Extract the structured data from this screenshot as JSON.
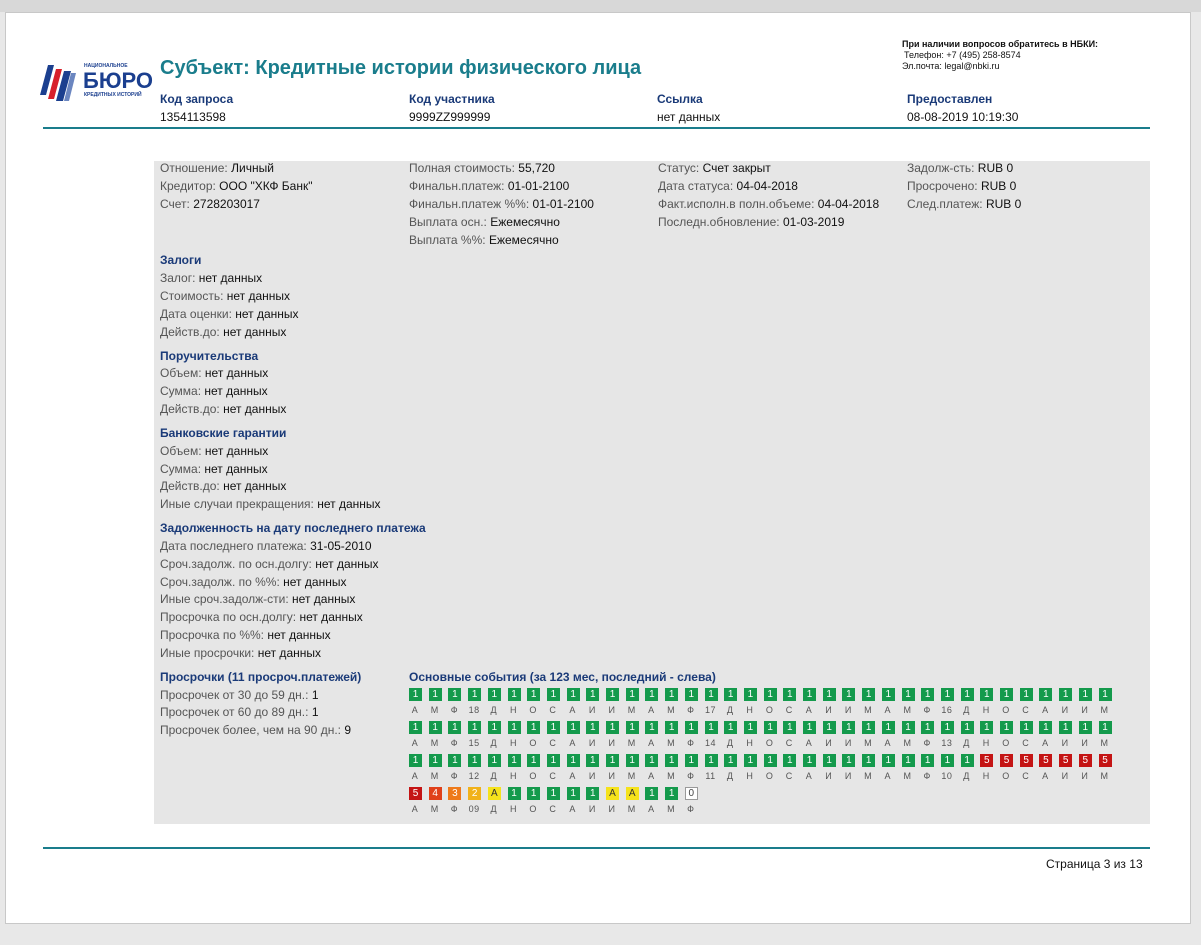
{
  "contact": {
    "title": "При наличии вопросов обратитесь в НБКИ:",
    "phone": "Телефон: +7 (495) 258-8574",
    "email": "Эл.почта: legal@nbki.ru"
  },
  "logo": {
    "top_text": "НАЦИОНАЛЬНОЕ",
    "main_text": "БЮРО",
    "bottom_text": "КРЕДИТНЫХ ИСТОРИЙ"
  },
  "title": "Субъект: Кредитные истории физического лица",
  "header": [
    {
      "label": "Код запроса",
      "value": "1354113598"
    },
    {
      "label": "Код участника",
      "value": "9999ZZ999999"
    },
    {
      "label": "Ссылка",
      "value": "нет данных"
    },
    {
      "label": "Предоставлен",
      "value": "08-08-2019 10:19:30"
    }
  ],
  "account": {
    "col1": [
      {
        "label": "Отношение:",
        "value": "Личный"
      },
      {
        "label": "Кредитор:",
        "value": "ООО \"ХКФ Банк\""
      },
      {
        "label": "Счет:",
        "value": "2728203017"
      }
    ],
    "col2": [
      {
        "label": "Полная стоимость:",
        "value": "55,720"
      },
      {
        "label": "Финальн.платеж:",
        "value": "01-01-2100"
      },
      {
        "label": "Финальн.платеж %%:",
        "value": "01-01-2100"
      },
      {
        "label": "Выплата осн.:",
        "value": "Ежемесячно"
      },
      {
        "label": "Выплата %%:",
        "value": "Ежемесячно"
      }
    ],
    "col3": [
      {
        "label": "Статус:",
        "value": "Счет закрыт"
      },
      {
        "label": "Дата статуса:",
        "value": "04-04-2018"
      },
      {
        "label": "Факт.исполн.в полн.объеме:",
        "value": "04-04-2018"
      },
      {
        "label": "Последн.обновление:",
        "value": "01-03-2019"
      }
    ],
    "col4": [
      {
        "label": "Задолж-сть:",
        "value": "RUB 0"
      },
      {
        "label": "Просрочено:",
        "value": "RUB 0"
      },
      {
        "label": "След.платеж:",
        "value": "RUB 0"
      }
    ]
  },
  "sections": {
    "pledges": {
      "title": "Залоги",
      "items": [
        {
          "label": "Залог:",
          "value": "нет данных"
        },
        {
          "label": "Стоимость:",
          "value": "нет данных"
        },
        {
          "label": "Дата оценки:",
          "value": "нет данных"
        },
        {
          "label": "Действ.до:",
          "value": "нет данных"
        }
      ]
    },
    "guarantees": {
      "title": "Поручительства",
      "items": [
        {
          "label": "Объем:",
          "value": "нет данных"
        },
        {
          "label": "Сумма:",
          "value": "нет данных"
        },
        {
          "label": "Действ.до:",
          "value": "нет данных"
        }
      ]
    },
    "bank_guarantees": {
      "title": "Банковские гарантии",
      "items": [
        {
          "label": "Объем:",
          "value": "нет данных"
        },
        {
          "label": "Сумма:",
          "value": "нет данных"
        },
        {
          "label": "Действ.до:",
          "value": "нет данных"
        },
        {
          "label": "Иные случаи прекращения:",
          "value": "нет данных"
        }
      ]
    },
    "debt": {
      "title": "Задолженность на дату последнего платежа",
      "items": [
        {
          "label": "Дата последнего платежа:",
          "value": "31-05-2010"
        },
        {
          "label": "Сроч.задолж. по осн.долгу:",
          "value": "нет данных"
        },
        {
          "label": "Сроч.задолж. по %%:",
          "value": "нет данных"
        },
        {
          "label": "Иные сроч.задолж-сти:",
          "value": "нет данных"
        },
        {
          "label": "Просрочка по осн.долгу:",
          "value": "нет данных"
        },
        {
          "label": "Просрочка по %%:",
          "value": "нет данных"
        },
        {
          "label": "Иные просрочки:",
          "value": "нет данных"
        }
      ]
    },
    "overdue": {
      "title": "Просрочки (11 просроч.платежей)",
      "items": [
        {
          "label": "Просрочек от 30 до 59 дн.:",
          "value": "1"
        },
        {
          "label": "Просрочек от 60 до 89 дн.:",
          "value": "1"
        },
        {
          "label": "Просрочек более, чем на 90 дн.:",
          "value": "9"
        }
      ]
    }
  },
  "events": {
    "title": "Основные события (за 123 мес, последний - слева)",
    "rows": [
      {
        "cells": [
          "1",
          "1",
          "1",
          "1",
          "1",
          "1",
          "1",
          "1",
          "1",
          "1",
          "1",
          "1",
          "1",
          "1",
          "1",
          "1",
          "1",
          "1",
          "1",
          "1",
          "1",
          "1",
          "1",
          "1",
          "1",
          "1",
          "1",
          "1",
          "1",
          "1",
          "1",
          "1",
          "1",
          "1",
          "1",
          "1"
        ],
        "months": [
          "А",
          "М",
          "Ф",
          "18",
          "Д",
          "Н",
          "О",
          "С",
          "А",
          "И",
          "И",
          "М",
          "А",
          "М",
          "Ф",
          "17",
          "Д",
          "Н",
          "О",
          "С",
          "А",
          "И",
          "И",
          "М",
          "А",
          "М",
          "Ф",
          "16",
          "Д",
          "Н",
          "О",
          "С",
          "А",
          "И",
          "И",
          "М"
        ]
      },
      {
        "cells": [
          "1",
          "1",
          "1",
          "1",
          "1",
          "1",
          "1",
          "1",
          "1",
          "1",
          "1",
          "1",
          "1",
          "1",
          "1",
          "1",
          "1",
          "1",
          "1",
          "1",
          "1",
          "1",
          "1",
          "1",
          "1",
          "1",
          "1",
          "1",
          "1",
          "1",
          "1",
          "1",
          "1",
          "1",
          "1",
          "1"
        ],
        "months": [
          "А",
          "М",
          "Ф",
          "15",
          "Д",
          "Н",
          "О",
          "С",
          "А",
          "И",
          "И",
          "М",
          "А",
          "М",
          "Ф",
          "14",
          "Д",
          "Н",
          "О",
          "С",
          "А",
          "И",
          "И",
          "М",
          "А",
          "М",
          "Ф",
          "13",
          "Д",
          "Н",
          "О",
          "С",
          "А",
          "И",
          "И",
          "М"
        ]
      },
      {
        "cells": [
          "1",
          "1",
          "1",
          "1",
          "1",
          "1",
          "1",
          "1",
          "1",
          "1",
          "1",
          "1",
          "1",
          "1",
          "1",
          "1",
          "1",
          "1",
          "1",
          "1",
          "1",
          "1",
          "1",
          "1",
          "1",
          "1",
          "1",
          "1",
          "1",
          "5",
          "5",
          "5",
          "5",
          "5",
          "5",
          "5"
        ],
        "months": [
          "А",
          "М",
          "Ф",
          "12",
          "Д",
          "Н",
          "О",
          "С",
          "А",
          "И",
          "И",
          "М",
          "А",
          "М",
          "Ф",
          "11",
          "Д",
          "Н",
          "О",
          "С",
          "А",
          "И",
          "И",
          "М",
          "А",
          "М",
          "Ф",
          "10",
          "Д",
          "Н",
          "О",
          "С",
          "А",
          "И",
          "И",
          "М"
        ]
      },
      {
        "cells": [
          "5",
          "4",
          "3",
          "2",
          "A",
          "1",
          "1",
          "1",
          "1",
          "1",
          "A",
          "A",
          "1",
          "1",
          "0"
        ],
        "months": [
          "А",
          "М",
          "Ф",
          "09",
          "Д",
          "Н",
          "О",
          "С",
          "А",
          "И",
          "И",
          "М",
          "А",
          "М",
          "Ф"
        ]
      }
    ]
  },
  "footer": {
    "page": "Страница 3 из 13"
  },
  "colors": {
    "accent": "#1a7d8c",
    "heading": "#1a3a78",
    "status_ok": "#149a4c",
    "status_90plus": "#c41414",
    "status_60": "#e0401a",
    "status_30": "#ee7a1a",
    "status_5": "#f1b21a",
    "status_closed": "#f5e21c"
  }
}
